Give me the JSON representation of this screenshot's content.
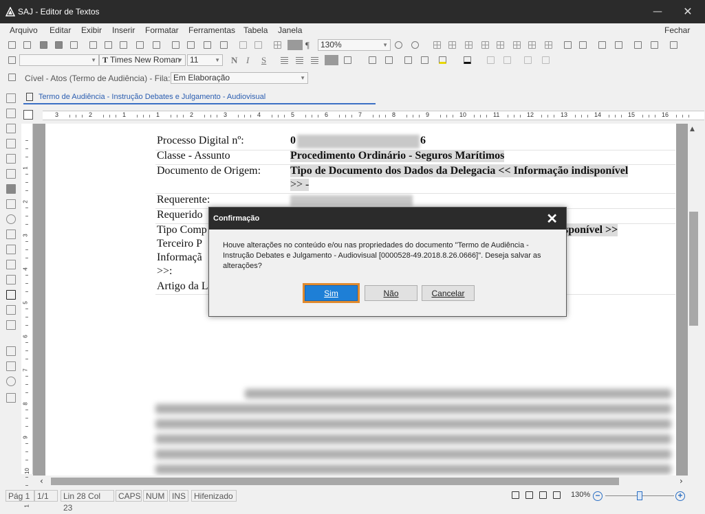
{
  "window": {
    "title": "SAJ - Editor de Textos",
    "minimize": "—",
    "close": "✕"
  },
  "menu": {
    "items": [
      "Arquivo",
      "Editar",
      "Exibir",
      "Inserir",
      "Formatar",
      "Ferramentas",
      "Tabela",
      "Janela"
    ],
    "right": "Fechar"
  },
  "toolbar": {
    "zoom": "130%",
    "font_family": "Times New Roman",
    "font_size": "11",
    "bold": "N",
    "italic": "I",
    "underline": "S"
  },
  "workflow": {
    "label": "Cível - Atos (Termo de Audiência) - Fila:",
    "queue_value": "Em Elaboração"
  },
  "document_tab": {
    "label": "Termo de Audiência - Instrução Debates e Julgamento - Audiovisual"
  },
  "ruler": {
    "numbers": [
      "3",
      "2",
      "1",
      "1",
      "2",
      "3",
      "4",
      "5",
      "6",
      "7",
      "8",
      "9",
      "10",
      "11",
      "12",
      "13",
      "14",
      "15",
      "16"
    ]
  },
  "vruler": {
    "numbers": [
      "1",
      "2",
      "3",
      "4",
      "5",
      "6",
      "7",
      "8",
      "9",
      "10",
      "11"
    ]
  },
  "document": {
    "rows": [
      {
        "label": "Processo Digital nº:",
        "value": "6"
      },
      {
        "label": "Classe - Assunto",
        "value": "Procedimento Ordinário - Seguros Marítimos"
      },
      {
        "label": "Documento de Origem:",
        "value": "Tipo de Documento dos Dados da Delegacia << Informação indisponível",
        "value2": ">>  -"
      },
      {
        "label": "Requerente:",
        "value": ""
      },
      {
        "label": "Requerido",
        "value": ""
      },
      {
        "label": "Tipo Comp",
        "value": "sponível >>"
      },
      {
        "label": "Terceiro P",
        "value": ""
      },
      {
        "label": "Informaçã",
        "value": ""
      },
      {
        "label": ">>:",
        "value": ""
      },
      {
        "label": "Artigo da L",
        "value": ""
      }
    ],
    "first_digit": "0"
  },
  "dialog": {
    "title": "Confirmação",
    "message": "Houve alterações no conteúdo e/ou nas propriedades do documento \"Termo de Audiência - Instrução Debates e Julgamento - Audiovisual [0000528-49.2018.8.26.0666]\". Deseja salvar as alterações?",
    "yes": "Sim",
    "no": "Não",
    "cancel": "Cancelar"
  },
  "status": {
    "page": "Pág 1",
    "pages": "1/1",
    "position": "Lin 28  Col 23",
    "caps": "CAPS",
    "num": "NUM",
    "ins": "INS",
    "hyphen": "Hifenizado",
    "zoom": "130%"
  },
  "colors": {
    "accent": "#1e7fd6",
    "focus_ring": "#e08a2e",
    "titlebar": "#2b2b2b"
  }
}
